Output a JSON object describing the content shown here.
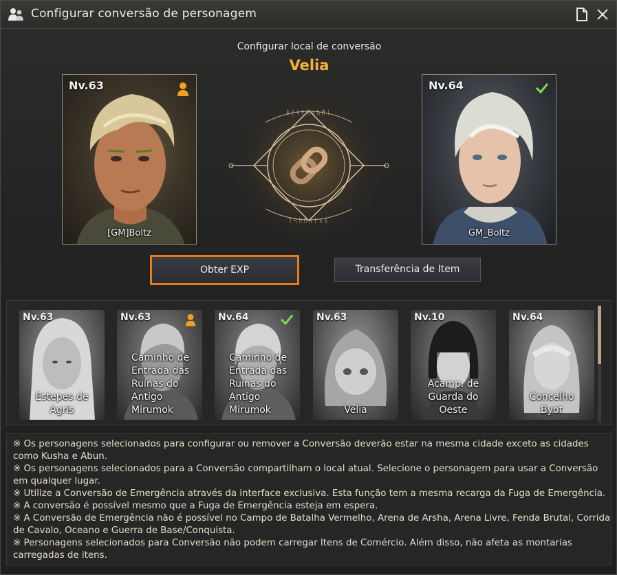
{
  "window": {
    "title": "Configurar conversão de personagem"
  },
  "header": {
    "label": "Configurar local de conversão",
    "city": "Velia"
  },
  "left_character": {
    "level": "Nv.63",
    "name": "[GM]Boltz",
    "badge": "person-icon"
  },
  "right_character": {
    "level": "Nv.64",
    "name": "GM_Boltz",
    "badge": "check-icon"
  },
  "buttons": {
    "obter_exp": "Obter EXP",
    "transfer": "Transferência de Item"
  },
  "characters": [
    {
      "level": "Nv.63",
      "location": [
        "Estepes de",
        "Agris"
      ],
      "badge": ""
    },
    {
      "level": "Nv.63",
      "location": [
        "Caminho de",
        "Entrada das",
        "Ruínas do",
        "Antigo",
        "Mirumok"
      ],
      "badge": "person-icon"
    },
    {
      "level": "Nv.64",
      "location": [
        "Caminho de",
        "Entrada das",
        "Ruínas do",
        "Antigo",
        "Mirumok"
      ],
      "badge": "check-icon"
    },
    {
      "level": "Nv.63",
      "location": [
        "Velia"
      ],
      "badge": ""
    },
    {
      "level": "Nv.10",
      "location": [
        "Acamp. de",
        "Guarda do",
        "Oeste"
      ],
      "badge": ""
    },
    {
      "level": "Nv.64",
      "location": [
        "Concelho",
        "Byot"
      ],
      "badge": ""
    }
  ],
  "notes": [
    "※ Os personagens selecionados para configurar ou remover a Conversão deverão estar na mesma cidade exceto as cidades como Kusha e Abun.",
    "※ Os personagens selecionados para a Conversão compartilham o local atual. Selecione o personagem para usar a Conversão em qualquer lugar.",
    "※ Utilize a Conversão de Emergência através da interface exclusiva. Esta função tem a mesma recarga da Fuga de Emergência.",
    "※ A conversão é possível mesmo que a Fuga de Emergência esteja em espera.",
    "※ A Conversão de Emergência não é possível no Campo de Batalha Vermelho, Arena de Arsha, Arena Livre, Fenda Brutal, Corrida de Cavalo, Oceano e Guerra de Base/Conquista.",
    "※ Personagens selecionados para Conversão não podem carregar Itens de Comércio. Além disso, não afeta as montarias carregadas de itens."
  ],
  "colors": {
    "accent": "#f2b23a",
    "selected_border": "#e87a1e",
    "check": "#7ed957",
    "person_badge": "#f0a020"
  }
}
